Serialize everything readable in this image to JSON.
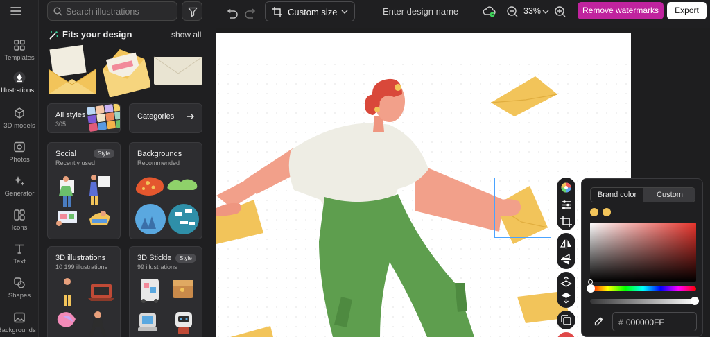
{
  "rail": {
    "items": [
      {
        "label": "Templates",
        "icon": "grid-icon"
      },
      {
        "label": "Illustrations",
        "icon": "pen-nib-icon"
      },
      {
        "label": "3D models",
        "icon": "cube-icon"
      },
      {
        "label": "Photos",
        "icon": "camera-icon"
      },
      {
        "label": "Generator",
        "icon": "sparkle-icon"
      },
      {
        "label": "Icons",
        "icon": "shapes-icon"
      },
      {
        "label": "Text",
        "icon": "text-icon"
      },
      {
        "label": "Shapes",
        "icon": "shapes-blob-icon"
      },
      {
        "label": "Backgrounds",
        "icon": "image-icon"
      }
    ],
    "active_index": 1
  },
  "panel": {
    "search_placeholder": "Search illustrations",
    "fits_title": "Fits your design",
    "show_all": "show all",
    "all_styles": {
      "title": "All styles",
      "count": "305"
    },
    "categories": {
      "title": "Categories"
    },
    "cards": [
      {
        "title": "Social",
        "subtitle": "Recently used",
        "badge": "Style"
      },
      {
        "title": "Backgrounds",
        "subtitle": "Recommended",
        "badge": ""
      },
      {
        "title": "3D illustrations",
        "subtitle": "10 199 illustrations",
        "badge": ""
      },
      {
        "title": "3D Stickle",
        "subtitle": "99 illustrations",
        "badge": "Style"
      }
    ]
  },
  "topbar": {
    "custom_size": "Custom size",
    "design_name_placeholder": "Enter design name",
    "zoom": "33%",
    "remove_watermarks": "Remove watermarks",
    "export": "Export"
  },
  "color_picker": {
    "tabs": [
      "Brand color",
      "Custom"
    ],
    "active_tab": 1,
    "hex_value": "000000FF",
    "swatches": [
      "#F2C45A",
      "#F2C45A"
    ],
    "hue": 0,
    "alpha": 1.0
  },
  "colors": {
    "accent": "#C0239E",
    "selection": "#4AA3FF",
    "envelope": "#F2C45A",
    "pants": "#5E9E4E",
    "shirt": "#EEEDE4",
    "skin": "#F2A08A"
  }
}
